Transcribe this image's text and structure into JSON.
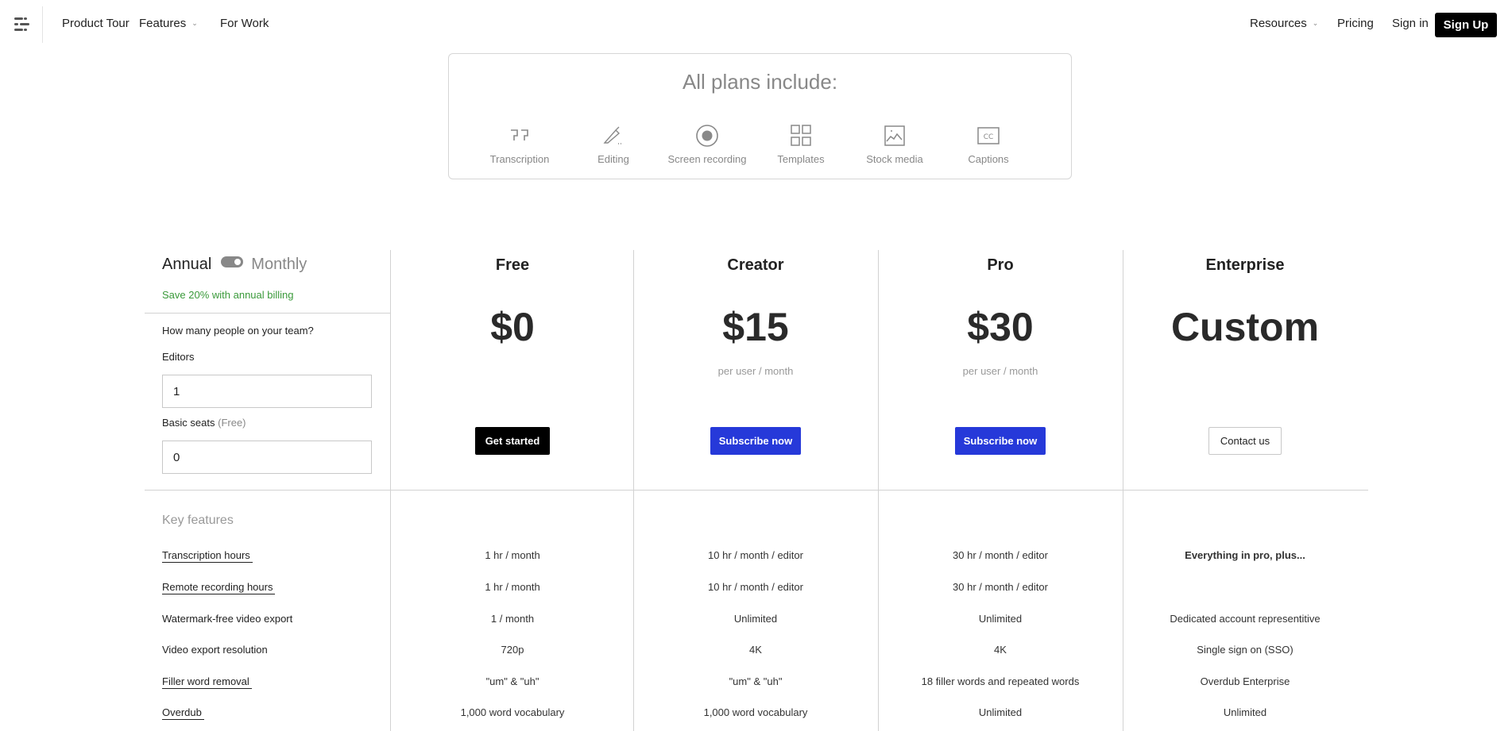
{
  "nav": {
    "left_items": [
      {
        "label": "Product Tour",
        "dropdown": false
      },
      {
        "label": "Features",
        "dropdown": true
      },
      {
        "label": "For Work",
        "dropdown": false
      }
    ],
    "right_items": [
      {
        "label": "Resources",
        "dropdown": true
      },
      {
        "label": "Pricing",
        "dropdown": false
      },
      {
        "label": "Sign in",
        "dropdown": false
      }
    ],
    "signup_label": "Sign Up",
    "chevron": "⌄"
  },
  "all_plans": {
    "title": "All plans include:",
    "items": [
      {
        "label": "Transcription",
        "icon": "quote-icon"
      },
      {
        "label": "Editing",
        "icon": "pencil-icon"
      },
      {
        "label": "Screen recording",
        "icon": "record-icon"
      },
      {
        "label": "Templates",
        "icon": "grid-icon"
      },
      {
        "label": "Stock media",
        "icon": "image-icon"
      },
      {
        "label": "Captions",
        "icon": "cc-icon"
      }
    ]
  },
  "billing": {
    "annual_label": "Annual",
    "monthly_label": "Monthly",
    "toggle_state": "monthly",
    "save_note": "Save 20% with annual billing"
  },
  "team": {
    "question": "How many people on your team?",
    "editors_label": "Editors",
    "editors_value": "1",
    "basic_label": "Basic seats",
    "basic_note": "(Free)",
    "basic_value": "0"
  },
  "plans": [
    {
      "name": "Free",
      "price": "$0",
      "unit": "",
      "button": "Get started",
      "button_style": "black"
    },
    {
      "name": "Creator",
      "price": "$15",
      "unit": "per user / month",
      "button": "Subscribe now",
      "button_style": "blue"
    },
    {
      "name": "Pro",
      "price": "$30",
      "unit": "per user / month",
      "button": "Subscribe now",
      "button_style": "blue"
    },
    {
      "name": "Enterprise",
      "price": "Custom",
      "unit": "",
      "button": "Contact us",
      "button_style": "outline"
    }
  ],
  "features": {
    "heading": "Key features",
    "rows": [
      {
        "name": "Transcription hours",
        "underlined": true,
        "values": [
          "1 hr / month",
          "10 hr / month / editor",
          "30 hr / month / editor",
          "Everything in pro, plus..."
        ]
      },
      {
        "name": "Remote recording hours",
        "underlined": true,
        "values": [
          "1 hr / month",
          "10 hr / month / editor",
          "30 hr / month / editor",
          ""
        ]
      },
      {
        "name": "Watermark-free video export",
        "underlined": false,
        "values": [
          "1 / month",
          "Unlimited",
          "Unlimited",
          "Dedicated account representitive"
        ]
      },
      {
        "name": "Video export resolution",
        "underlined": false,
        "values": [
          "720p",
          "4K",
          "4K",
          "Single sign on (SSO)"
        ]
      },
      {
        "name": "Filler word removal",
        "underlined": true,
        "values": [
          "\"um\" & \"uh\"",
          "\"um\" & \"uh\"",
          "18 filler words and repeated words",
          "Overdub Enterprise"
        ]
      },
      {
        "name": "Overdub",
        "underlined": true,
        "values": [
          "1,000 word vocabulary",
          "1,000 word vocabulary",
          "Unlimited",
          "Unlimited"
        ]
      }
    ]
  },
  "colors": {
    "accent_blue": "#2639d9",
    "save_green": "#3a9a3a",
    "signup_black": "#000000"
  }
}
